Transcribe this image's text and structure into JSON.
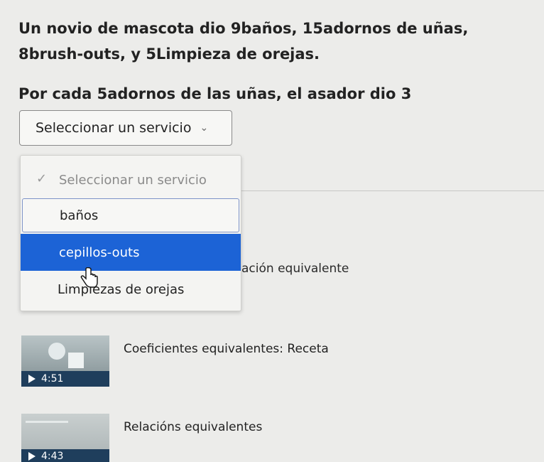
{
  "problem": {
    "text": "Un novio de mascota dio 9baños, 15adornos de uñas, 8brush-outs, y 5Limpieza de orejas."
  },
  "prompt": {
    "text": "Por cada 5adornos de las uñas, el asador dio 3"
  },
  "select": {
    "value": "Seleccionar un servicio",
    "options": [
      {
        "label": "Seleccionar un servicio",
        "state": "placeholder-checked"
      },
      {
        "label": "baños",
        "state": "focused"
      },
      {
        "label": "cepillos-outs",
        "state": "highlighted"
      },
      {
        "label": "Limpiezas de orejas",
        "state": "normal"
      }
    ]
  },
  "behind_text": "ación equivalente",
  "videos": [
    {
      "title": "Coeficientes equivalentes: Receta",
      "duration": "4:51"
    },
    {
      "title": "Relacións equivalentes",
      "duration": "4:43"
    }
  ],
  "colors": {
    "highlight": "#1c63d6",
    "focus_border": "#7d93c8",
    "video_bar": "#1f3e5c"
  }
}
